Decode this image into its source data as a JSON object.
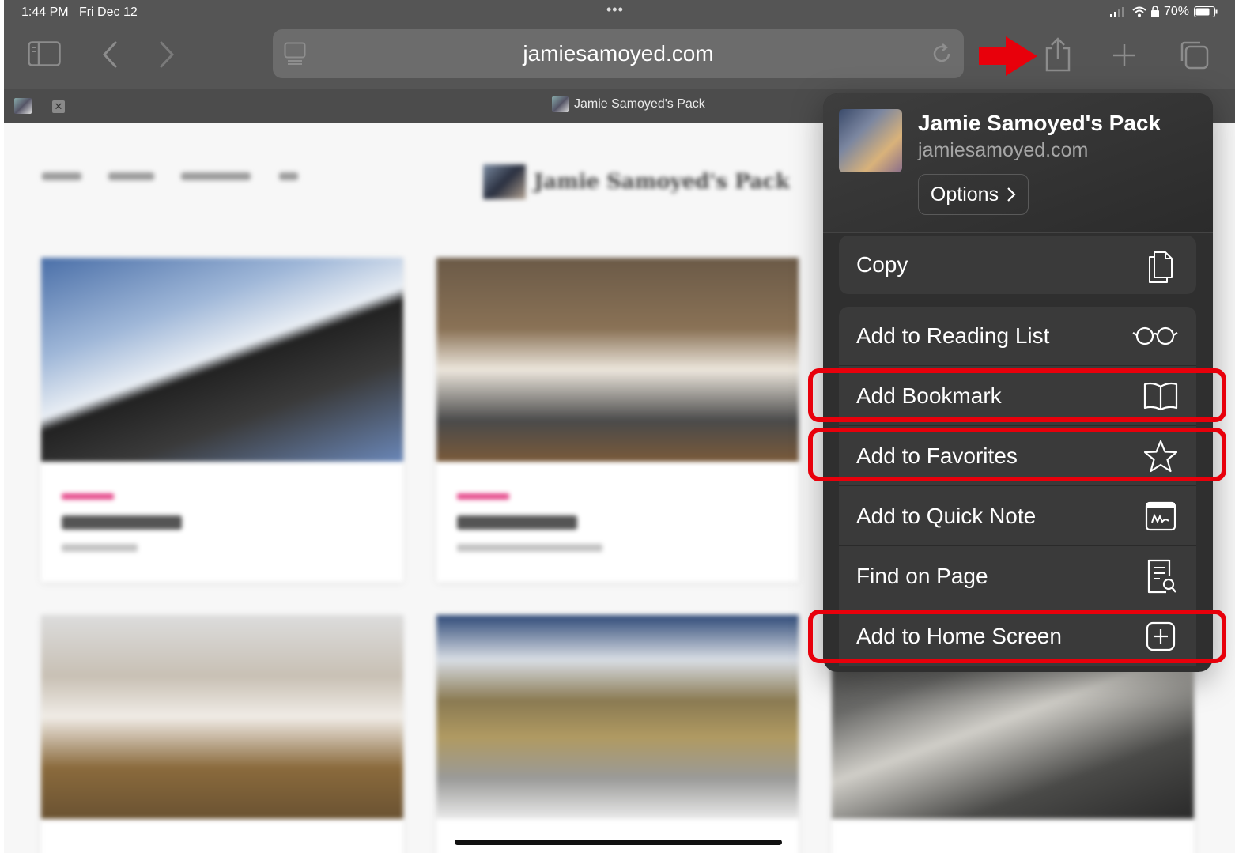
{
  "status": {
    "time": "1:44 PM",
    "date": "Fri Dec 12",
    "battery": "70%"
  },
  "browser": {
    "url": "jamiesamoyed.com",
    "tab_title": "Jamie Samoyed's Pack"
  },
  "share_sheet": {
    "title": "Jamie Samoyed's Pack",
    "domain": "jamiesamoyed.com",
    "options_label": "Options",
    "actions": [
      {
        "label": "Copy",
        "icon": "copy-icon"
      },
      {
        "label": "Add to Reading List",
        "icon": "glasses-icon"
      },
      {
        "label": "Add Bookmark",
        "icon": "book-icon"
      },
      {
        "label": "Add to Favorites",
        "icon": "star-icon"
      },
      {
        "label": "Add to Quick Note",
        "icon": "quick-note-icon"
      },
      {
        "label": "Find on Page",
        "icon": "find-on-page-icon"
      },
      {
        "label": "Add to Home Screen",
        "icon": "add-square-icon"
      }
    ]
  },
  "annotation_color": "#e8000b",
  "accent_pink": "#e5488a"
}
